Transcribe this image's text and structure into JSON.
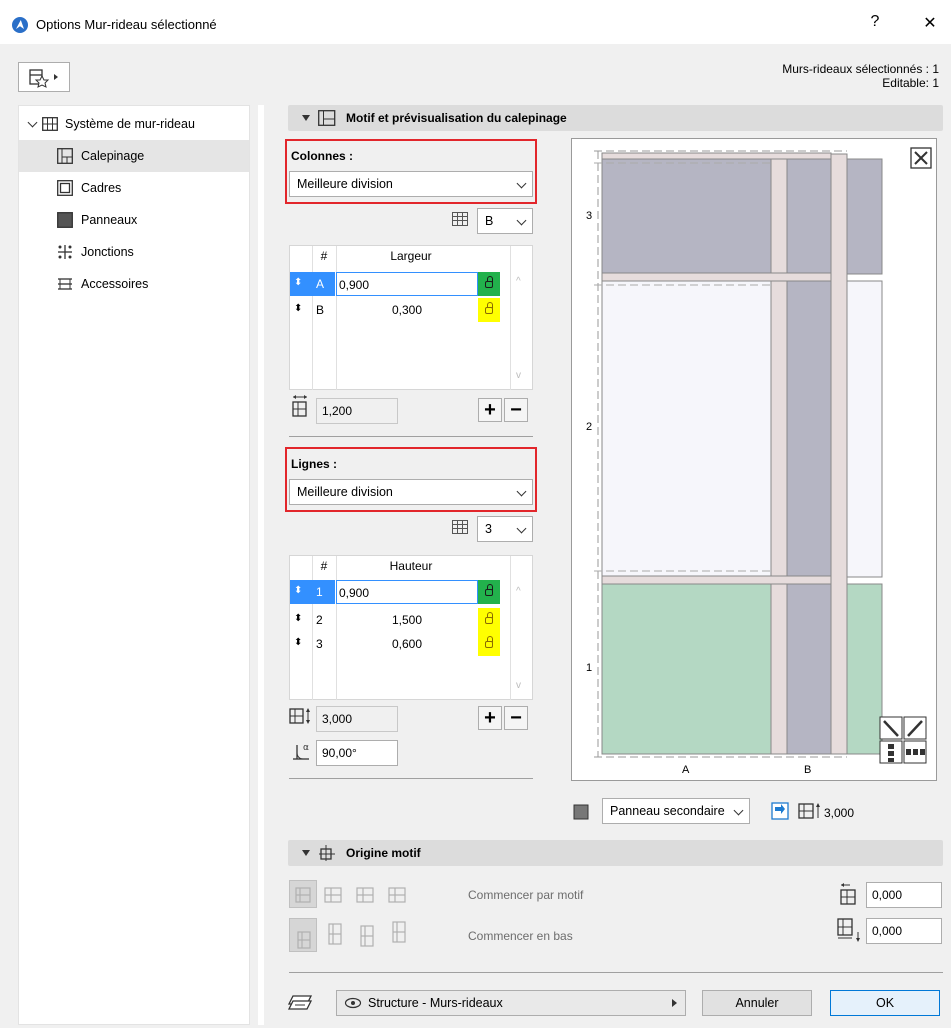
{
  "window": {
    "title": "Options Mur-rideau sélectionné",
    "help": "?",
    "close": "✕"
  },
  "selection_info": {
    "line1": "Murs-rideaux sélectionnés : 1",
    "line2": "Editable: 1"
  },
  "tree": {
    "root": "Système de mur-rideau",
    "items": [
      {
        "label": "Calepinage",
        "icon": "pattern-icon",
        "selected": true
      },
      {
        "label": "Cadres",
        "icon": "frame-icon"
      },
      {
        "label": "Panneaux",
        "icon": "panel-icon"
      },
      {
        "label": "Jonctions",
        "icon": "junction-icon"
      },
      {
        "label": "Accessoires",
        "icon": "accessory-icon"
      }
    ]
  },
  "pattern_section": {
    "title": "Motif et prévisualisation du calepinage",
    "columns": {
      "label": "Colonnes :",
      "mode": "Meilleure division",
      "repeat_select": "B",
      "header_num": "#",
      "header_value": "Largeur",
      "rows": [
        {
          "id": "A",
          "value": "0,900",
          "lock": "green",
          "selected": true
        },
        {
          "id": "B",
          "value": "0,300",
          "lock": "yellow"
        }
      ],
      "total": "1,200"
    },
    "rows_group": {
      "label": "Lignes :",
      "mode": "Meilleure division",
      "repeat_select": "3",
      "header_num": "#",
      "header_value": "Hauteur",
      "rows": [
        {
          "id": "1",
          "value": "0,900",
          "lock": "green",
          "selected": true
        },
        {
          "id": "2",
          "value": "1,500",
          "lock": "yellow"
        },
        {
          "id": "3",
          "value": "0,600",
          "lock": "yellow"
        }
      ],
      "total": "3,000",
      "angle": "90,00°"
    },
    "preview": {
      "row_labels": [
        "3",
        "2",
        "1"
      ],
      "col_labels": [
        "A",
        "B"
      ],
      "panel_type": "Panneau secondaire",
      "height_value": "3,000"
    }
  },
  "origin_section": {
    "title": "Origine motif",
    "start_pattern_label": "Commencer par motif",
    "start_bottom_label": "Commencer en bas",
    "offset_x": "0,000",
    "offset_y": "0,000"
  },
  "footer": {
    "layer": "Structure - Murs-rideaux",
    "cancel": "Annuler",
    "ok": "OK"
  }
}
